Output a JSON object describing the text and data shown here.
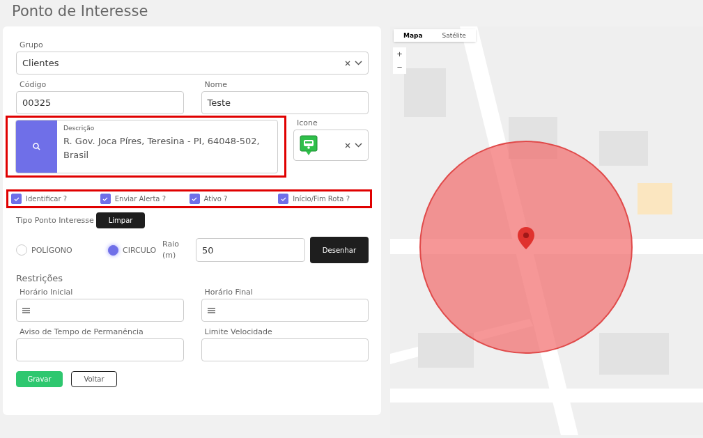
{
  "page_title": "Ponto de Interesse",
  "grupo": {
    "label": "Grupo",
    "value": "Clientes"
  },
  "codigo": {
    "label": "Código",
    "value": "00325"
  },
  "nome": {
    "label": "Nome",
    "value": "Teste"
  },
  "descricao": {
    "label": "Descrição",
    "value": "R. Gov. Joca Píres, Teresina - PI, 64048-502, Brasil",
    "highlighted": true
  },
  "icone": {
    "label": "Icone"
  },
  "options_highlighted": true,
  "options": [
    {
      "label": "Identificar ?",
      "checked": true
    },
    {
      "label": "Enviar Alerta ?",
      "checked": true
    },
    {
      "label": "Ativo ?",
      "checked": true
    },
    {
      "label": "Início/Fim Rota ?",
      "checked": true
    }
  ],
  "tipo": {
    "label": "Tipo Ponto Interesse",
    "clear_button": "Limpar"
  },
  "shapes": [
    {
      "label": "POLÍGONO",
      "selected": false
    },
    {
      "label": "CIRCULO",
      "selected": true
    }
  ],
  "raio": {
    "label": "Raio (m)",
    "value": "50",
    "button": "Desenhar"
  },
  "restricoes": {
    "title": "Restrições",
    "fields": [
      {
        "label": "Horário Inicial",
        "kind": "time"
      },
      {
        "label": "Horário Final",
        "kind": "time"
      },
      {
        "label": "Aviso de Tempo de Permanência",
        "kind": "text"
      },
      {
        "label": "Limite Velocidade",
        "kind": "text"
      }
    ]
  },
  "buttons": [
    {
      "label": "Gravar",
      "kind": "primary"
    },
    {
      "label": "Voltar",
      "kind": "outline"
    }
  ],
  "map": {
    "kind": "picture",
    "types": [
      {
        "label": "Mapa",
        "selected": true
      },
      {
        "label": "Satélite",
        "selected": false
      }
    ],
    "zoom": [
      "+",
      "−"
    ]
  }
}
